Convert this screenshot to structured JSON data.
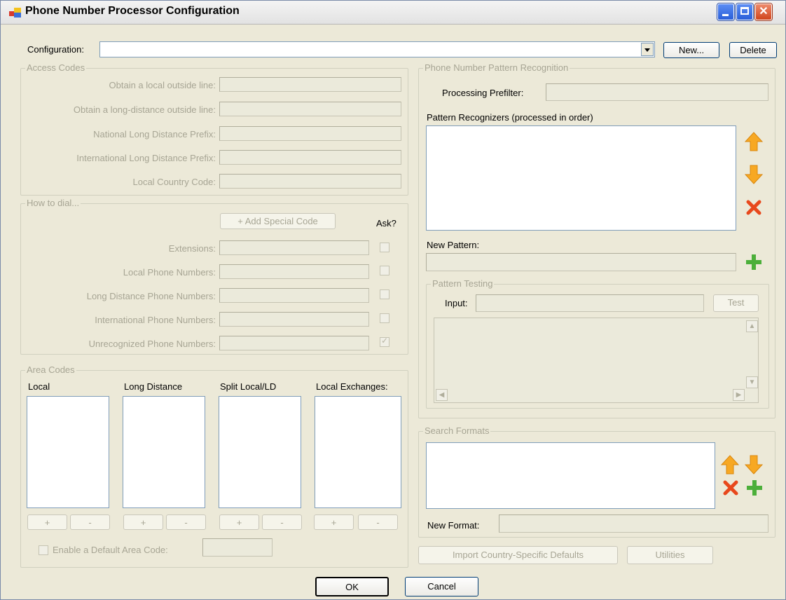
{
  "window": {
    "title": "Phone Number Processor Configuration"
  },
  "config": {
    "label": "Configuration:",
    "value": "",
    "new_label": "New...",
    "delete_label": "Delete"
  },
  "access_codes": {
    "title": "Access Codes",
    "rows": [
      {
        "label": "Obtain a local outside line:",
        "value": ""
      },
      {
        "label": "Obtain a long-distance outside line:",
        "value": ""
      },
      {
        "label": "National Long Distance Prefix:",
        "value": ""
      },
      {
        "label": "International Long Distance Prefix:",
        "value": ""
      },
      {
        "label": "Local Country Code:",
        "value": ""
      }
    ]
  },
  "how_to_dial": {
    "title": "How to dial...",
    "add_special_label": "+ Add Special Code",
    "ask_label": "Ask?",
    "rows": [
      {
        "label": "Extensions:",
        "value": "",
        "ask": false
      },
      {
        "label": "Local Phone Numbers:",
        "value": "",
        "ask": false
      },
      {
        "label": "Long Distance Phone Numbers:",
        "value": "",
        "ask": false
      },
      {
        "label": "International Phone Numbers:",
        "value": "",
        "ask": false
      },
      {
        "label": "Unrecognized Phone Numbers:",
        "value": "",
        "ask": true
      }
    ]
  },
  "area_codes": {
    "title": "Area Codes",
    "columns": [
      "Local",
      "Long Distance",
      "Split Local/LD",
      "Local Exchanges:"
    ],
    "add_label": "+",
    "remove_label": "-",
    "default_label": "Enable a Default Area Code:",
    "default_checked": false,
    "default_value": ""
  },
  "pattern": {
    "title": "Phone Number Pattern Recognition",
    "prefilter_label": "Processing Prefilter:",
    "prefilter_value": "",
    "recognizers_label": "Pattern Recognizers (processed in order)",
    "new_pattern_label": "New Pattern:",
    "new_pattern_value": "",
    "testing": {
      "title": "Pattern Testing",
      "input_label": "Input:",
      "input_value": "",
      "test_label": "Test"
    }
  },
  "search_formats": {
    "title": "Search Formats",
    "new_format_label": "New Format:",
    "new_format_value": ""
  },
  "footer": {
    "import_label": "Import Country-Specific Defaults",
    "utilities_label": "Utilities",
    "ok_label": "OK",
    "cancel_label": "Cancel"
  },
  "colors": {
    "arrow_orange": "#f7a823",
    "delete_red": "#e8481c",
    "add_green": "#4caf3a",
    "window_face": "#ece9d8"
  }
}
